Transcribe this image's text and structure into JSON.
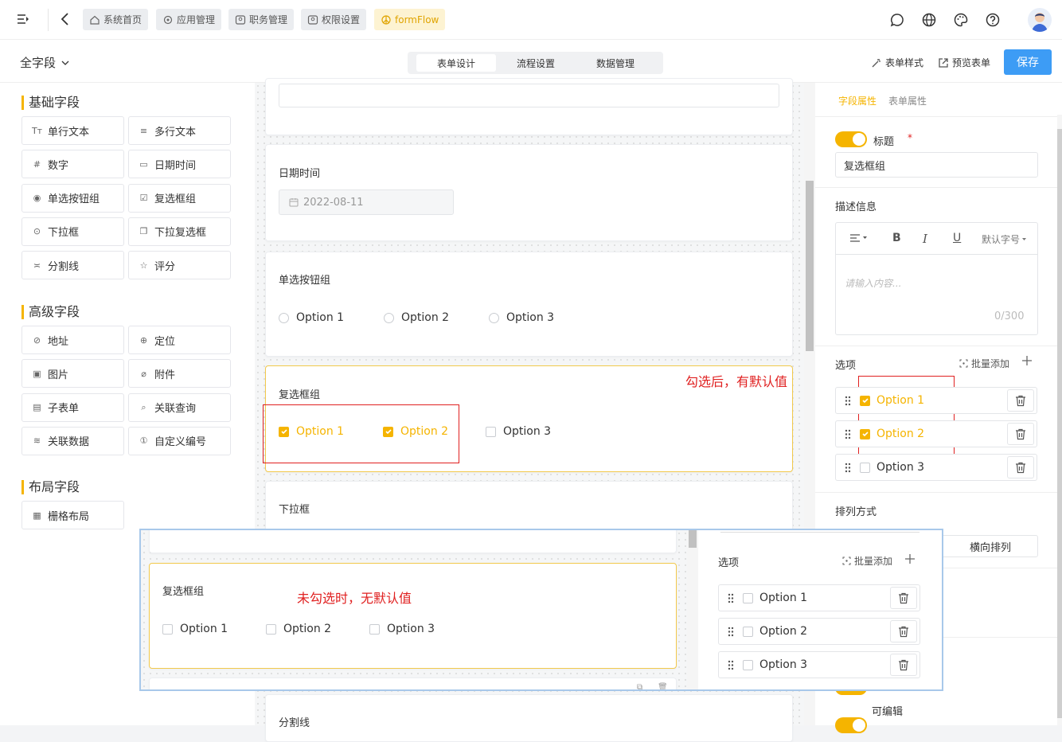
{
  "topbar": {
    "tabs": [
      "系统首页",
      "应用管理",
      "职务管理",
      "权限设置",
      "formFlow"
    ]
  },
  "subbar": {
    "field_select": "全字段",
    "seg_tabs": [
      "表单设计",
      "流程设置",
      "数据管理"
    ],
    "form_style": "表单样式",
    "preview": "预览表单",
    "save": "保存"
  },
  "left": {
    "basic_title": "基础字段",
    "basic": [
      {
        "icon": "Tт",
        "label": "单行文本"
      },
      {
        "icon": "≡",
        "label": "多行文本"
      },
      {
        "icon": "#",
        "label": "数字"
      },
      {
        "icon": "▭",
        "label": "日期时间"
      },
      {
        "icon": "◉",
        "label": "单选按钮组"
      },
      {
        "icon": "☑",
        "label": "复选框组"
      },
      {
        "icon": "⊙",
        "label": "下拉框"
      },
      {
        "icon": "❐",
        "label": "下拉复选框"
      },
      {
        "icon": "≍",
        "label": "分割线"
      },
      {
        "icon": "☆",
        "label": "评分"
      }
    ],
    "advanced_title": "高级字段",
    "advanced": [
      {
        "icon": "⊘",
        "label": "地址"
      },
      {
        "icon": "⊕",
        "label": "定位"
      },
      {
        "icon": "▣",
        "label": "图片"
      },
      {
        "icon": "⌀",
        "label": "附件"
      },
      {
        "icon": "▤",
        "label": "子表单"
      },
      {
        "icon": "⌕",
        "label": "关联查询"
      },
      {
        "icon": "≋",
        "label": "关联数据"
      },
      {
        "icon": "①",
        "label": "自定义编号"
      }
    ],
    "layout_title": "布局字段",
    "layout": [
      {
        "icon": "▦",
        "label": "栅格布局"
      }
    ]
  },
  "canvas": {
    "date_label": "日期时间",
    "date_value": "2022-08-11",
    "radio_label": "单选按钮组",
    "radio_options": [
      "Option 1",
      "Option 2",
      "Option 3"
    ],
    "checkbox_label": "复选框组",
    "checkbox_options": [
      "Option 1",
      "Option 2",
      "Option 3"
    ],
    "checkbox_note": "勾选后，有默认值",
    "select_label": "下拉框",
    "divider_label": "分割线"
  },
  "right": {
    "tabs": [
      "字段属性",
      "表单属性"
    ],
    "title_label": "标题",
    "title_value": "复选框组",
    "desc_label": "描述信息",
    "editor_font": "默认字号",
    "editor_placeholder": "请输入内容...",
    "editor_count": "0/300",
    "options_label": "选项",
    "batch_add": "批量添加",
    "options": [
      {
        "label": "Option 1",
        "checked": true
      },
      {
        "label": "Option 2",
        "checked": true
      },
      {
        "label": "Option 3",
        "checked": false
      }
    ],
    "arrange_label": "排列方式",
    "arrange_value": "横向排列",
    "editable_label": "可编辑"
  },
  "overlay": {
    "checkbox_label": "复选框组",
    "note": "未勾选时，无默认值",
    "options": [
      "Option 1",
      "Option 2",
      "Option 3"
    ],
    "options_label": "选项",
    "batch_add": "批量添加"
  },
  "colors": {
    "accent": "#f5b400",
    "primary": "#3d9cf5",
    "annotation": "#e02020"
  }
}
